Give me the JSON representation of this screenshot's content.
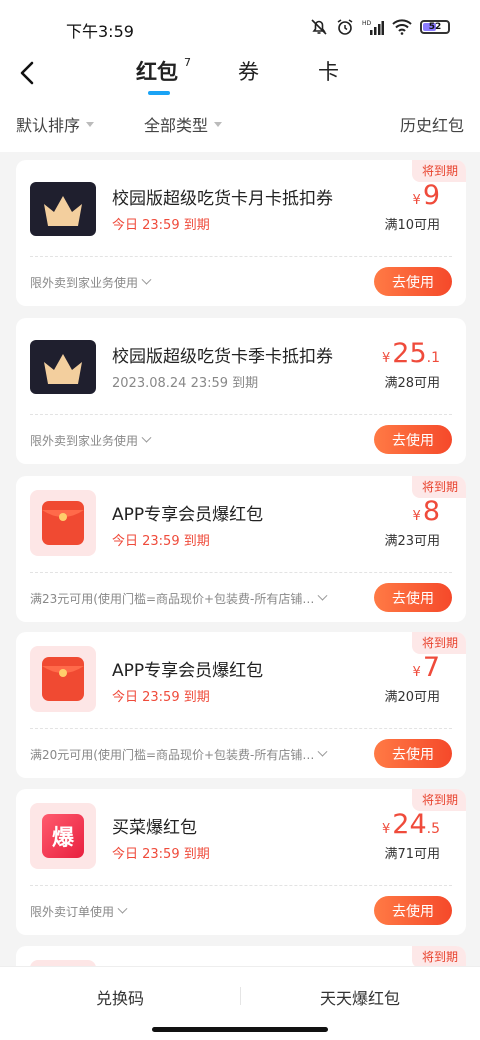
{
  "status": {
    "time": "下午3:59",
    "battery": "52"
  },
  "tabs": [
    {
      "label": "红包",
      "badge": "7"
    },
    {
      "label": "券"
    },
    {
      "label": "卡"
    }
  ],
  "filters": {
    "sort": "默认排序",
    "type": "全部类型",
    "history": "历史红包"
  },
  "cards": [
    {
      "tag": "将到期",
      "title": "校园版超级吃货卡月卡抵扣券",
      "expire": "今日 23:59 到期",
      "currency": "¥",
      "amount": "9",
      "decimal": "",
      "condition": "满10可用",
      "scope": "限外卖到家业务使用",
      "button": "去使用",
      "icon": "crown-icon"
    },
    {
      "tag": "",
      "title": "校园版超级吃货卡季卡抵扣券",
      "expire": "2023.08.24 23:59 到期",
      "currency": "¥",
      "amount": "25",
      "decimal": ".1",
      "condition": "满28可用",
      "scope": "限外卖到家业务使用",
      "button": "去使用",
      "icon": "crown-icon"
    },
    {
      "tag": "将到期",
      "title": "APP专享会员爆红包",
      "expire": "今日 23:59 到期",
      "currency": "¥",
      "amount": "8",
      "decimal": "",
      "condition": "满23可用",
      "scope": "满23元可用(使用门槛=商品现价+包装费-所有店铺…",
      "button": "去使用",
      "icon": "red-envelope-icon"
    },
    {
      "tag": "将到期",
      "title": "APP专享会员爆红包",
      "expire": "今日 23:59 到期",
      "currency": "¥",
      "amount": "7",
      "decimal": "",
      "condition": "满20可用",
      "scope": "满20元可用(使用门槛=商品现价+包装费-所有店铺…",
      "button": "去使用",
      "icon": "red-envelope-icon"
    },
    {
      "tag": "将到期",
      "title": "买菜爆红包",
      "expire": "今日 23:59 到期",
      "currency": "¥",
      "amount": "24",
      "decimal": ".5",
      "condition": "满71可用",
      "scope": "限外卖订单使用",
      "button": "去使用",
      "icon": "bao-icon",
      "icon_text": "爆"
    },
    {
      "tag": "将到期"
    }
  ],
  "bottom": {
    "left": "兑换码",
    "right": "天天爆红包"
  },
  "colors": {
    "accent": "#ef4b3b",
    "tab_indicator": "#1aa3f5"
  }
}
